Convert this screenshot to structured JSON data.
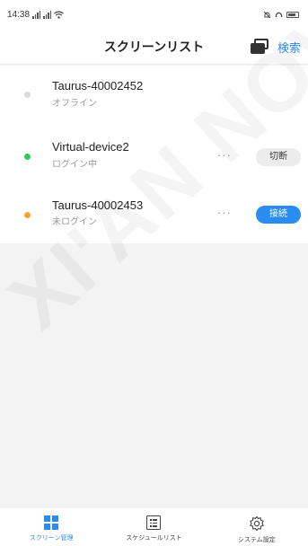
{
  "status_bar": {
    "time": "14:38",
    "signal_text": "⁴ᴳ",
    "wifi_icon": "wifi-icon",
    "right_icons": [
      "alarm-icon",
      "headset-icon",
      "battery-icon"
    ]
  },
  "header": {
    "title": "スクリーンリスト",
    "search_label": "検索",
    "screens_icon": "screens-icon"
  },
  "devices": [
    {
      "name": "Taurus-40002452",
      "status": "オフライン",
      "status_color": "#d9d9d9",
      "action": null
    },
    {
      "name": "Virtual-device2",
      "status": "ログイン中",
      "status_color": "#2ecc5a",
      "action": "切断",
      "more": "···"
    },
    {
      "name": "Taurus-40002453",
      "status": "未ログイン",
      "status_color": "#ff9f2a",
      "action": "接続",
      "more": "···"
    }
  ],
  "watermark": "XI'AN NOVA",
  "tabbar": {
    "items": [
      {
        "label": "スクリーン管理",
        "icon": "grid-icon",
        "active": true
      },
      {
        "label": "スケジュールリスト",
        "icon": "list-icon",
        "active": false
      },
      {
        "label": "システム設定",
        "icon": "gear-icon",
        "active": false
      }
    ]
  },
  "colors": {
    "accent": "#2a8cf0",
    "online": "#2ecc5a",
    "not_logged_in": "#ff9f2a",
    "offline": "#d9d9d9"
  }
}
